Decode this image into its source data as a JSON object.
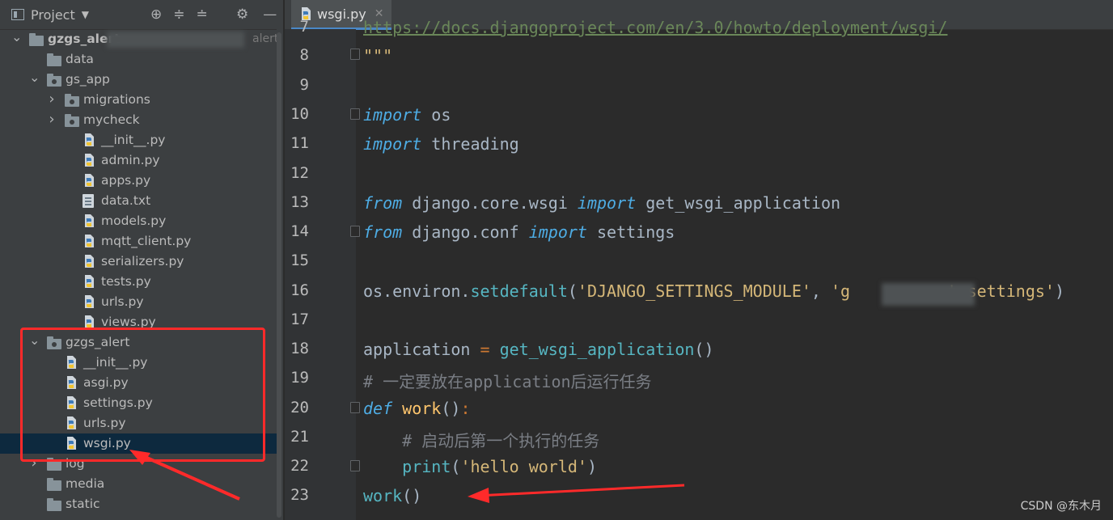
{
  "sidebar": {
    "title": "Project",
    "tree": [
      {
        "label": "gzgs_alert",
        "type": "folder",
        "expanded": true,
        "suffix": "alert"
      },
      {
        "label": "data",
        "type": "folder"
      },
      {
        "label": "gs_app",
        "type": "package",
        "expanded": true
      },
      {
        "label": "migrations",
        "type": "package",
        "expanded": false
      },
      {
        "label": "mycheck",
        "type": "package",
        "expanded": false
      },
      {
        "label": "__init__.py",
        "type": "py"
      },
      {
        "label": "admin.py",
        "type": "py"
      },
      {
        "label": "apps.py",
        "type": "py"
      },
      {
        "label": "data.txt",
        "type": "txt"
      },
      {
        "label": "models.py",
        "type": "py"
      },
      {
        "label": "mqtt_client.py",
        "type": "py"
      },
      {
        "label": "serializers.py",
        "type": "py"
      },
      {
        "label": "tests.py",
        "type": "py"
      },
      {
        "label": "urls.py",
        "type": "py"
      },
      {
        "label": "views.py",
        "type": "py"
      },
      {
        "label": "gzgs_alert",
        "type": "package",
        "expanded": true
      },
      {
        "label": "__init__.py",
        "type": "py"
      },
      {
        "label": "asgi.py",
        "type": "py"
      },
      {
        "label": "settings.py",
        "type": "py"
      },
      {
        "label": "urls.py",
        "type": "py"
      },
      {
        "label": "wsgi.py",
        "type": "py",
        "selected": true
      },
      {
        "label": "log",
        "type": "folder",
        "expanded": false
      },
      {
        "label": "media",
        "type": "folder"
      },
      {
        "label": "static",
        "type": "folder"
      }
    ]
  },
  "editor": {
    "tab_label": "wsgi.py",
    "line_numbers": [
      "7",
      "8",
      "9",
      "10",
      "11",
      "12",
      "13",
      "14",
      "15",
      "16",
      "17",
      "18",
      "19",
      "20",
      "21",
      "22",
      "23"
    ]
  },
  "watermark": "CSDN @东木月",
  "colors": {
    "annotation": "#ff2a2a",
    "selection": "#0d293e"
  }
}
